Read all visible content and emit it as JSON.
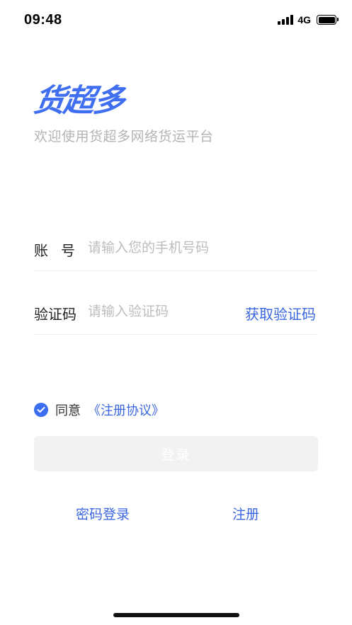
{
  "status_bar": {
    "time": "09:48",
    "network": "4G",
    "signal_icon": "signal-bars-icon",
    "battery_icon": "battery-full-icon"
  },
  "brand": {
    "logo_text": "货超多",
    "welcome": "欢迎使用货超多网络货运平台",
    "accent_color": "#3f6ff0"
  },
  "form": {
    "account_label": "账号",
    "account_placeholder": "请输入您的手机号码",
    "code_label": "验证码",
    "code_placeholder": "请输入验证码",
    "get_code_label": "获取验证码"
  },
  "agreement": {
    "checked": true,
    "agree_text": "同意",
    "link_text": "《注册协议》"
  },
  "actions": {
    "login_label": "登录",
    "password_login_label": "密码登录",
    "register_label": "注册"
  }
}
